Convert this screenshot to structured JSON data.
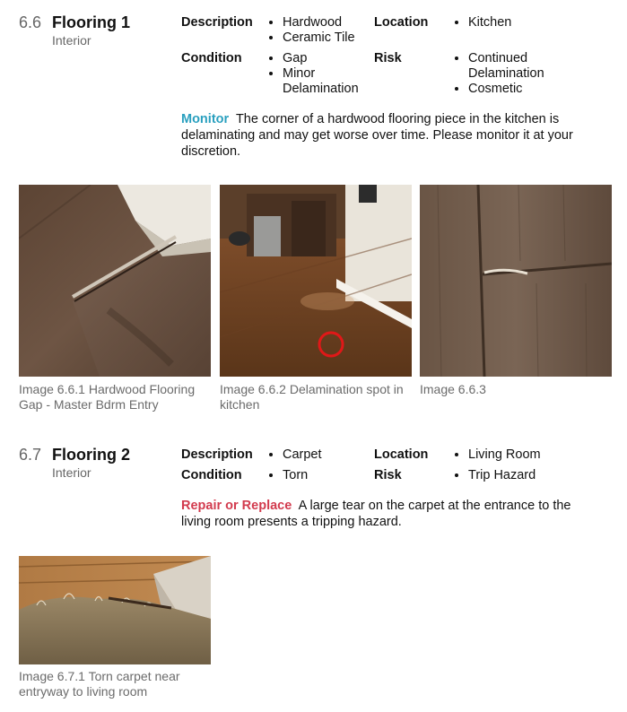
{
  "sections": [
    {
      "number": "6.6",
      "title": "Flooring 1",
      "subtitle": "Interior",
      "labels": {
        "description": "Description",
        "location": "Location",
        "condition": "Condition",
        "risk": "Risk"
      },
      "description": [
        "Hardwood",
        "Ceramic Tile"
      ],
      "location": [
        "Kitchen"
      ],
      "condition": [
        "Gap",
        "Minor Delamination"
      ],
      "risk": [
        "Continued Delamination",
        "Cosmetic"
      ],
      "note_tag": "Monitor",
      "note_text": "The corner of a hardwood flooring piece in the kitchen is delaminating and may get worse over time. Please monitor it at your discretion.",
      "images": [
        {
          "caption": "Image 6.6.1 Hardwood Flooring Gap - Master Bdrm Entry"
        },
        {
          "caption": "Image 6.6.2 Delamination spot in kitchen"
        },
        {
          "caption": "Image 6.6.3"
        }
      ]
    },
    {
      "number": "6.7",
      "title": "Flooring 2",
      "subtitle": "Interior",
      "labels": {
        "description": "Description",
        "location": "Location",
        "condition": "Condition",
        "risk": "Risk"
      },
      "description": [
        "Carpet"
      ],
      "location": [
        "Living Room"
      ],
      "condition": [
        "Torn"
      ],
      "risk": [
        "Trip Hazard"
      ],
      "note_tag": "Repair or Replace",
      "note_text": "A large tear on the carpet at the entrance to the living room presents a tripping hazard.",
      "images": [
        {
          "caption": "Image 6.7.1 Torn carpet near entryway to living room"
        }
      ]
    }
  ],
  "colors": {
    "monitor": "#2aa0bf",
    "repair": "#d23b4e",
    "caption": "#6b6b6b"
  }
}
